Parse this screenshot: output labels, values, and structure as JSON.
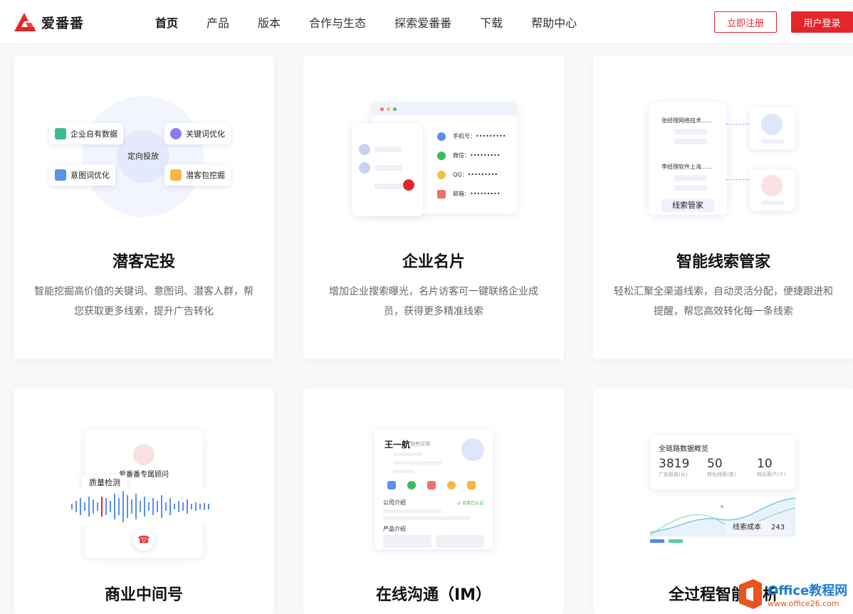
{
  "header": {
    "logo_text": "爱番番",
    "nav": [
      "首页",
      "产品",
      "版本",
      "合作与生态",
      "探索爱番番",
      "下载",
      "帮助中心"
    ],
    "register_label": "立即注册",
    "login_label": "用户登录",
    "brand_color": "#e4262b"
  },
  "cards": [
    {
      "title": "潜客定投",
      "desc_line1": "智能挖掘高价值的关键词、意图词、潜客人群，帮",
      "desc_line2": "您获取更多线索，提升广告转化",
      "ill": {
        "center": "定向投放",
        "tags": [
          "企业自有数据",
          "关键词优化",
          "意图词优化",
          "潜客包挖掘"
        ]
      }
    },
    {
      "title": "企业名片",
      "desc_line1": "增加企业搜索曝光，名片访客可一键联络企业成",
      "desc_line2": "员，获得更多精准线索",
      "ill": {
        "phone": "手机号：•••••••••",
        "wechat": "微信：•••••••••",
        "qq": "QQ：•••••••••",
        "email": "邮箱：•••••••••"
      }
    },
    {
      "title": "智能线索管家",
      "desc_line1": "轻松汇聚全渠道线索，自动灵活分配，便捷跟进和",
      "desc_line2": "提醒，帮您高效转化每一条线索",
      "ill": {
        "lead1": "张经理网络技术......",
        "lead2": "李经理软件上海......",
        "footer": "线索管家"
      }
    },
    {
      "title": "商业中间号",
      "ill": {
        "consultant": "爱番番专属顾问",
        "quality": "质量检测"
      }
    },
    {
      "title": "在线沟通（IM）",
      "ill": {
        "name": "王一航",
        "role": "销售经理",
        "company_intro": "公司介绍",
        "verified": "◎ 百度已认证",
        "product_intro": "产品介绍"
      }
    },
    {
      "title": "全过程智能分析",
      "ill": {
        "overview": "全链路数据概览",
        "stats": [
          {
            "value": "3819",
            "label": "广告投放(元)"
          },
          {
            "value": "50",
            "label": "转化线索(条)"
          },
          {
            "value": "10",
            "label": "转化客户(个)"
          }
        ],
        "cost_label": "线索成本",
        "cost_value": "243"
      }
    }
  ],
  "watermark": {
    "line1": "Office教程网",
    "line2": "www.office26.com"
  }
}
